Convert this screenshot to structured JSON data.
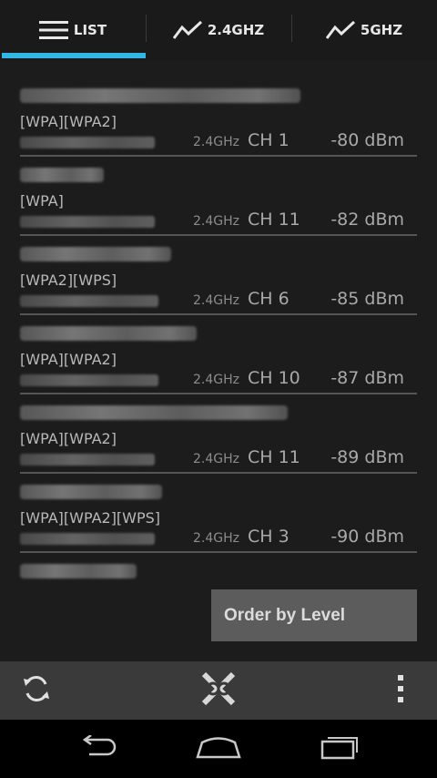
{
  "tabs": [
    {
      "label": "LIST",
      "icon": "menu-icon",
      "active": true
    },
    {
      "label": "2.4GHZ",
      "icon": "line-chart-icon",
      "active": false
    },
    {
      "label": "5GHZ",
      "icon": "line-chart-icon",
      "active": false
    }
  ],
  "colors": {
    "accent": "#33b5e5",
    "background": "#1c1c1c",
    "action_bar": "#3a3a3a"
  },
  "networks": [
    {
      "security": "[WPA][WPA2]",
      "band": "2.4GHz",
      "channel": "CH 1",
      "level": "-80 dBm"
    },
    {
      "security": "[WPA]",
      "band": "2.4GHz",
      "channel": "CH 11",
      "level": "-82 dBm"
    },
    {
      "security": "[WPA2][WPS]",
      "band": "2.4GHz",
      "channel": "CH 6",
      "level": "-85 dBm"
    },
    {
      "security": "[WPA][WPA2]",
      "band": "2.4GHz",
      "channel": "CH 10",
      "level": "-87 dBm"
    },
    {
      "security": "[WPA][WPA2]",
      "band": "2.4GHz",
      "channel": "CH 11",
      "level": "-89 dBm"
    },
    {
      "security": "[WPA][WPA2][WPS]",
      "band": "2.4GHz",
      "channel": "CH 3",
      "level": "-90 dBm"
    }
  ],
  "order_button": "Order by Level",
  "action_bar": {
    "refresh_icon": "refresh-icon",
    "app_icon": "app-logo-icon",
    "overflow_icon": "overflow-menu-icon"
  },
  "nav_bar": {
    "back_icon": "back-icon",
    "home_icon": "home-icon",
    "recents_icon": "recents-icon"
  }
}
